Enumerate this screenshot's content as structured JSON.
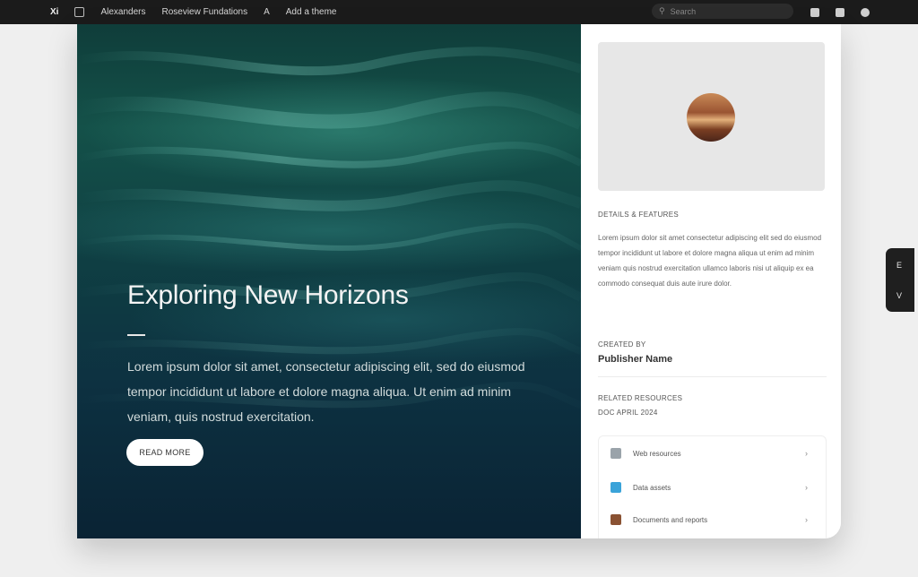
{
  "topbar": {
    "logo": "Xi",
    "nav": [
      "Alexanders",
      "Roseview Fundations",
      "A",
      "Add a theme"
    ],
    "search_placeholder": "Search"
  },
  "hero": {
    "title": "Exploring New Horizons",
    "body": "Lorem ipsum dolor sit amet, consectetur adipiscing elit, sed do eiusmod tempor incididunt ut labore et dolore magna aliqua. Ut enim ad minim veniam, quis nostrud exercitation.",
    "button_label": "READ MORE"
  },
  "sidebar": {
    "section_title": "DETAILS & FEATURES",
    "description": "Lorem ipsum dolor sit amet consectetur adipiscing elit sed do eiusmod tempor incididunt ut labore et dolore magna aliqua ut enim ad minim veniam quis nostrud exercitation ullamco laboris nisi ut aliquip ex ea commodo consequat duis aute irure dolor.",
    "meta_label": "CREATED BY",
    "meta_value": "Publisher Name",
    "meta_sub_label": "RELATED RESOURCES",
    "meta_sub_value": "DOC APRIL 2024",
    "list_items": [
      {
        "label": "Web resources",
        "color": "#9aa3aa"
      },
      {
        "label": "Data assets",
        "color": "#3aa3d9"
      },
      {
        "label": "Documents and reports",
        "color": "#8a5233"
      }
    ]
  },
  "float_widget": {
    "top_glyph": "E",
    "bottom_glyph": "V"
  },
  "colors": {
    "topbar_bg": "#1b1b1b",
    "hero_teal": "#145149",
    "accent_dark": "#0a2334"
  }
}
